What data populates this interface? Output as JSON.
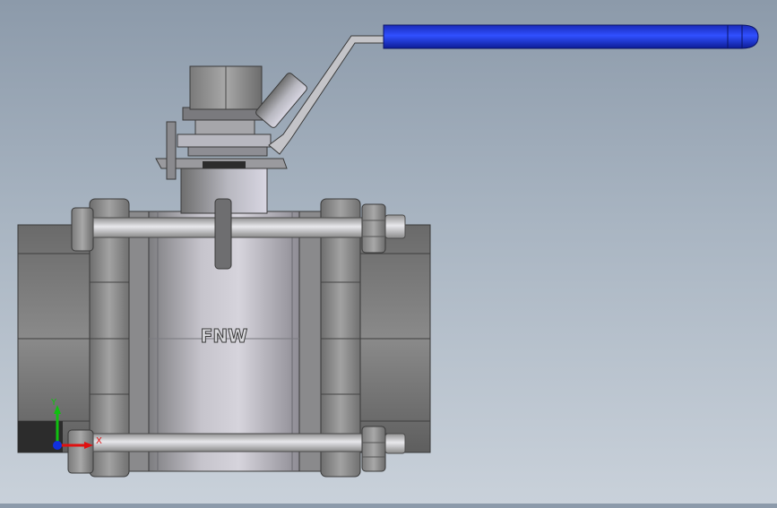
{
  "model": {
    "body_marking": "FNW"
  },
  "triad": {
    "x_label": "X",
    "y_label": "Y"
  },
  "colors": {
    "background_top": "#8c9aaa",
    "background_bottom": "#c9d1da",
    "handle_grip": "#1c2fd6",
    "steel_mid": "#9a9a9a",
    "steel_dark": "#5c5c5c",
    "axis_x": "#e01010",
    "axis_y": "#10c010",
    "axis_z": "#1030e0"
  }
}
